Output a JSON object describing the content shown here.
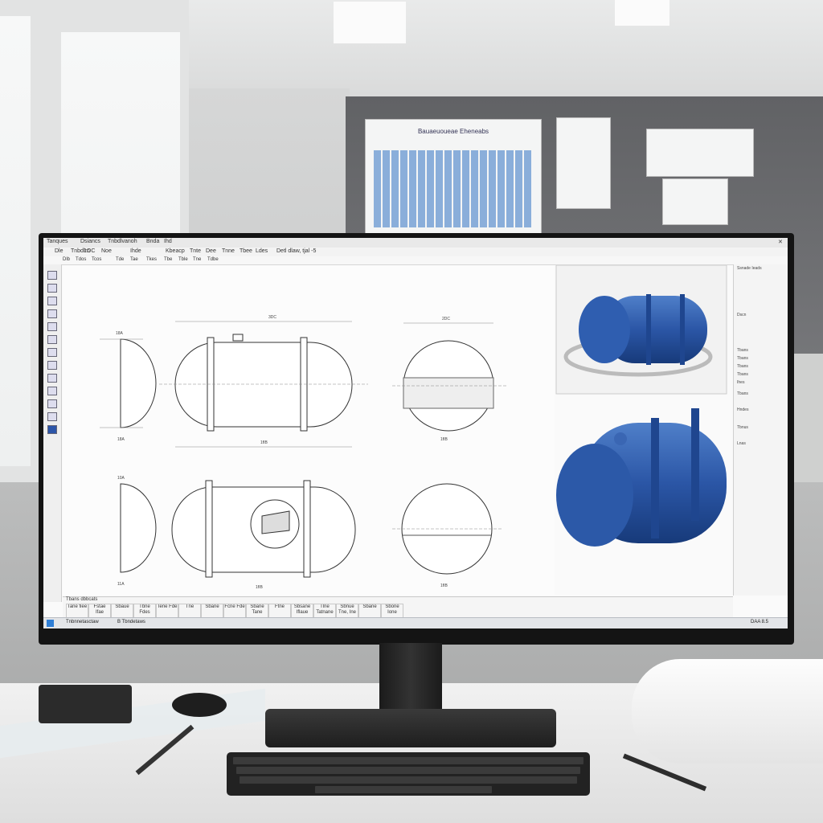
{
  "app": {
    "window_title": "Tanques",
    "title_items": [
      "Dsiancs",
      "Tnbdlvanoh",
      "Bnda",
      "Ihd"
    ],
    "menu_items": [
      "Dle",
      "Tnbdlrn",
      "1OC",
      "Noe",
      "Ihde",
      "Kbeacp",
      "Tnte",
      "Dee",
      "Tnne",
      "Tbee",
      "Ldes",
      "Detl dlaw, tjal -5"
    ],
    "toolbar_items": [
      "Dlb",
      "Tdos",
      "Tcos",
      "Tde",
      "Tae",
      "Tkes",
      "Tbe",
      "Tble",
      "Tne",
      "Tdbe"
    ]
  },
  "drawing": {
    "dims_top": [
      "3DC",
      "2DC"
    ],
    "dims_bottom": [
      "1fIB",
      "1fIB",
      "1fIB",
      "1fIB"
    ],
    "dim_small": [
      "18A",
      "18A",
      "10A",
      "11A"
    ]
  },
  "right_panel": {
    "header": "Ssnade Ieads",
    "items": [
      "Dscn",
      "Tbans",
      "Tbans",
      "Tbans",
      "Tbans",
      "Ihes",
      "Tbans",
      "Hndes",
      "Tbnus",
      "Lnas"
    ]
  },
  "bottom_panel": {
    "header": "Tbans dbbcats",
    "cells": [
      "Tane fiee",
      "Fstae Ifae",
      "Sbaue",
      "Tbne Fdes",
      "Tene Fde",
      "Tne",
      "Sbane",
      "Fcne Fde",
      "Sbane Tane",
      "Ftne",
      "Sbsane Iflaue",
      "Tlne Tatnane",
      "Sbnue Tne, Ine",
      "Sbane",
      "Sbone Ione"
    ]
  },
  "taskbar": {
    "items": [
      "Tnbnnetasctaw",
      "B Tbndetaws"
    ],
    "clock": "DAA 8.5"
  },
  "posters": {
    "periodic_title": "Bauaeuoueae Eheneabs"
  }
}
